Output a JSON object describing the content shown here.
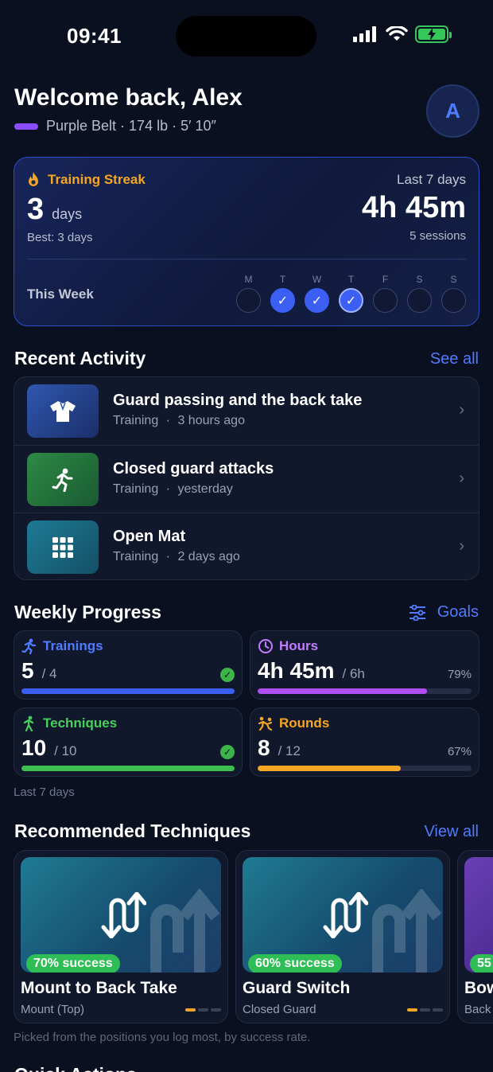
{
  "status_bar": {
    "time": "09:41"
  },
  "header": {
    "welcome": "Welcome back, Alex",
    "profile_line": "Purple Belt · 174 lb · 5′ 10″",
    "avatar_initial": "A"
  },
  "streak": {
    "title": "Training Streak",
    "count": "3",
    "unit": "days",
    "best": "Best: 3 days",
    "period_label": "Last 7 days",
    "total_time": "4h 45m",
    "sessions": "5 sessions",
    "week_label": "This Week",
    "days": [
      {
        "letter": "M",
        "done": false
      },
      {
        "letter": "T",
        "done": true
      },
      {
        "letter": "W",
        "done": true
      },
      {
        "letter": "T",
        "done": true,
        "today": true
      },
      {
        "letter": "F",
        "done": false
      },
      {
        "letter": "S",
        "done": false
      },
      {
        "letter": "S",
        "done": false
      }
    ]
  },
  "recent_activity": {
    "title": "Recent Activity",
    "see_all": "See all",
    "items": [
      {
        "title": "Guard passing and the back take",
        "type": "Training",
        "time": "3 hours ago",
        "icon": "gi-icon"
      },
      {
        "title": "Closed guard attacks",
        "type": "Training",
        "time": "yesterday",
        "icon": "running-icon"
      },
      {
        "title": "Open Mat",
        "type": "Training",
        "time": "2 days ago",
        "icon": "grid-icon"
      }
    ],
    "separator": "·"
  },
  "weekly_progress": {
    "title": "Weekly Progress",
    "goals_label": "Goals",
    "footnote": "Last 7 days",
    "cards": [
      {
        "label": "Trainings",
        "value": "5",
        "target": "/ 4",
        "progress": 1.0,
        "complete": true,
        "color": "#3a5ff2",
        "label_color": "#4f7cff",
        "icon": "running-icon"
      },
      {
        "label": "Hours",
        "value": "4h 45m",
        "target": "/ 6h",
        "percent": "79%",
        "progress": 0.79,
        "complete": false,
        "color": "#b04ef5",
        "label_color": "#c07cff",
        "icon": "clock-icon"
      },
      {
        "label": "Techniques",
        "value": "10",
        "target": "/ 10",
        "progress": 1.0,
        "complete": true,
        "color": "#3bbf4e",
        "label_color": "#46d15c",
        "icon": "figure-icon"
      },
      {
        "label": "Rounds",
        "value": "8",
        "target": "/ 12",
        "percent": "67%",
        "progress": 0.67,
        "complete": false,
        "color": "#f5a623",
        "label_color": "#f5a623",
        "icon": "wrestling-icon"
      }
    ]
  },
  "techniques": {
    "title": "Recommended Techniques",
    "view_all": "View all",
    "footnote": "Picked from the positions you log most, by success rate.",
    "items": [
      {
        "badge": "70% success",
        "name": "Mount to Back Take",
        "position": "Mount (Top)",
        "difficulty": 1
      },
      {
        "badge": "60% success",
        "name": "Guard Switch",
        "position": "Closed Guard",
        "difficulty": 1
      },
      {
        "badge": "55",
        "name": "Bow",
        "position": "Back"
      }
    ]
  },
  "quick_actions": {
    "title": "Quick Actions"
  }
}
